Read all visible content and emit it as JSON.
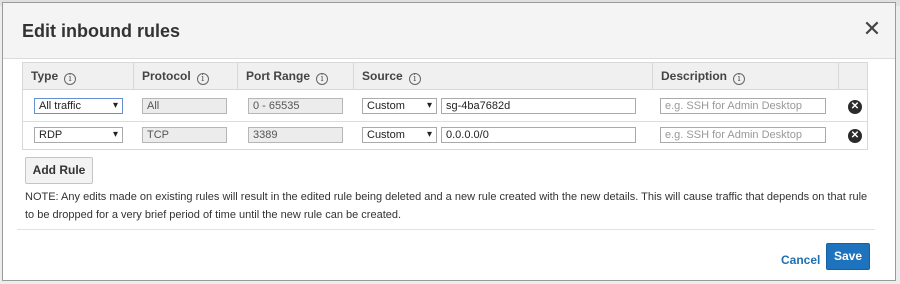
{
  "dialog": {
    "title": "Edit inbound rules",
    "close_label": "✕"
  },
  "table": {
    "headers": {
      "type": "Type",
      "protocol": "Protocol",
      "port_range": "Port Range",
      "source": "Source",
      "description": "Description"
    },
    "info_icon_glyph": "i",
    "rows": [
      {
        "type": "All traffic",
        "protocol": "All",
        "port_range": "0 - 65535",
        "source_type": "Custom",
        "source_value": "sg-4ba7682d",
        "description_placeholder": "e.g. SSH for Admin Desktop"
      },
      {
        "type": "RDP",
        "protocol": "TCP",
        "port_range": "3389",
        "source_type": "Custom",
        "source_value": "0.0.0.0/0",
        "description_placeholder": "e.g. SSH for Admin Desktop"
      }
    ],
    "delete_glyph": "✕"
  },
  "actions": {
    "add_rule": "Add Rule",
    "cancel": "Cancel",
    "save": "Save"
  },
  "note": "NOTE: Any edits made on existing rules will result in the edited rule being deleted and a new rule created with the new details. This will cause traffic that depends on that rule to be dropped for a very brief period of time until the new rule can be created.",
  "colors": {
    "primary": "#1e73be",
    "link": "#1f6fb2",
    "header_bg": "#f4f4f4"
  }
}
